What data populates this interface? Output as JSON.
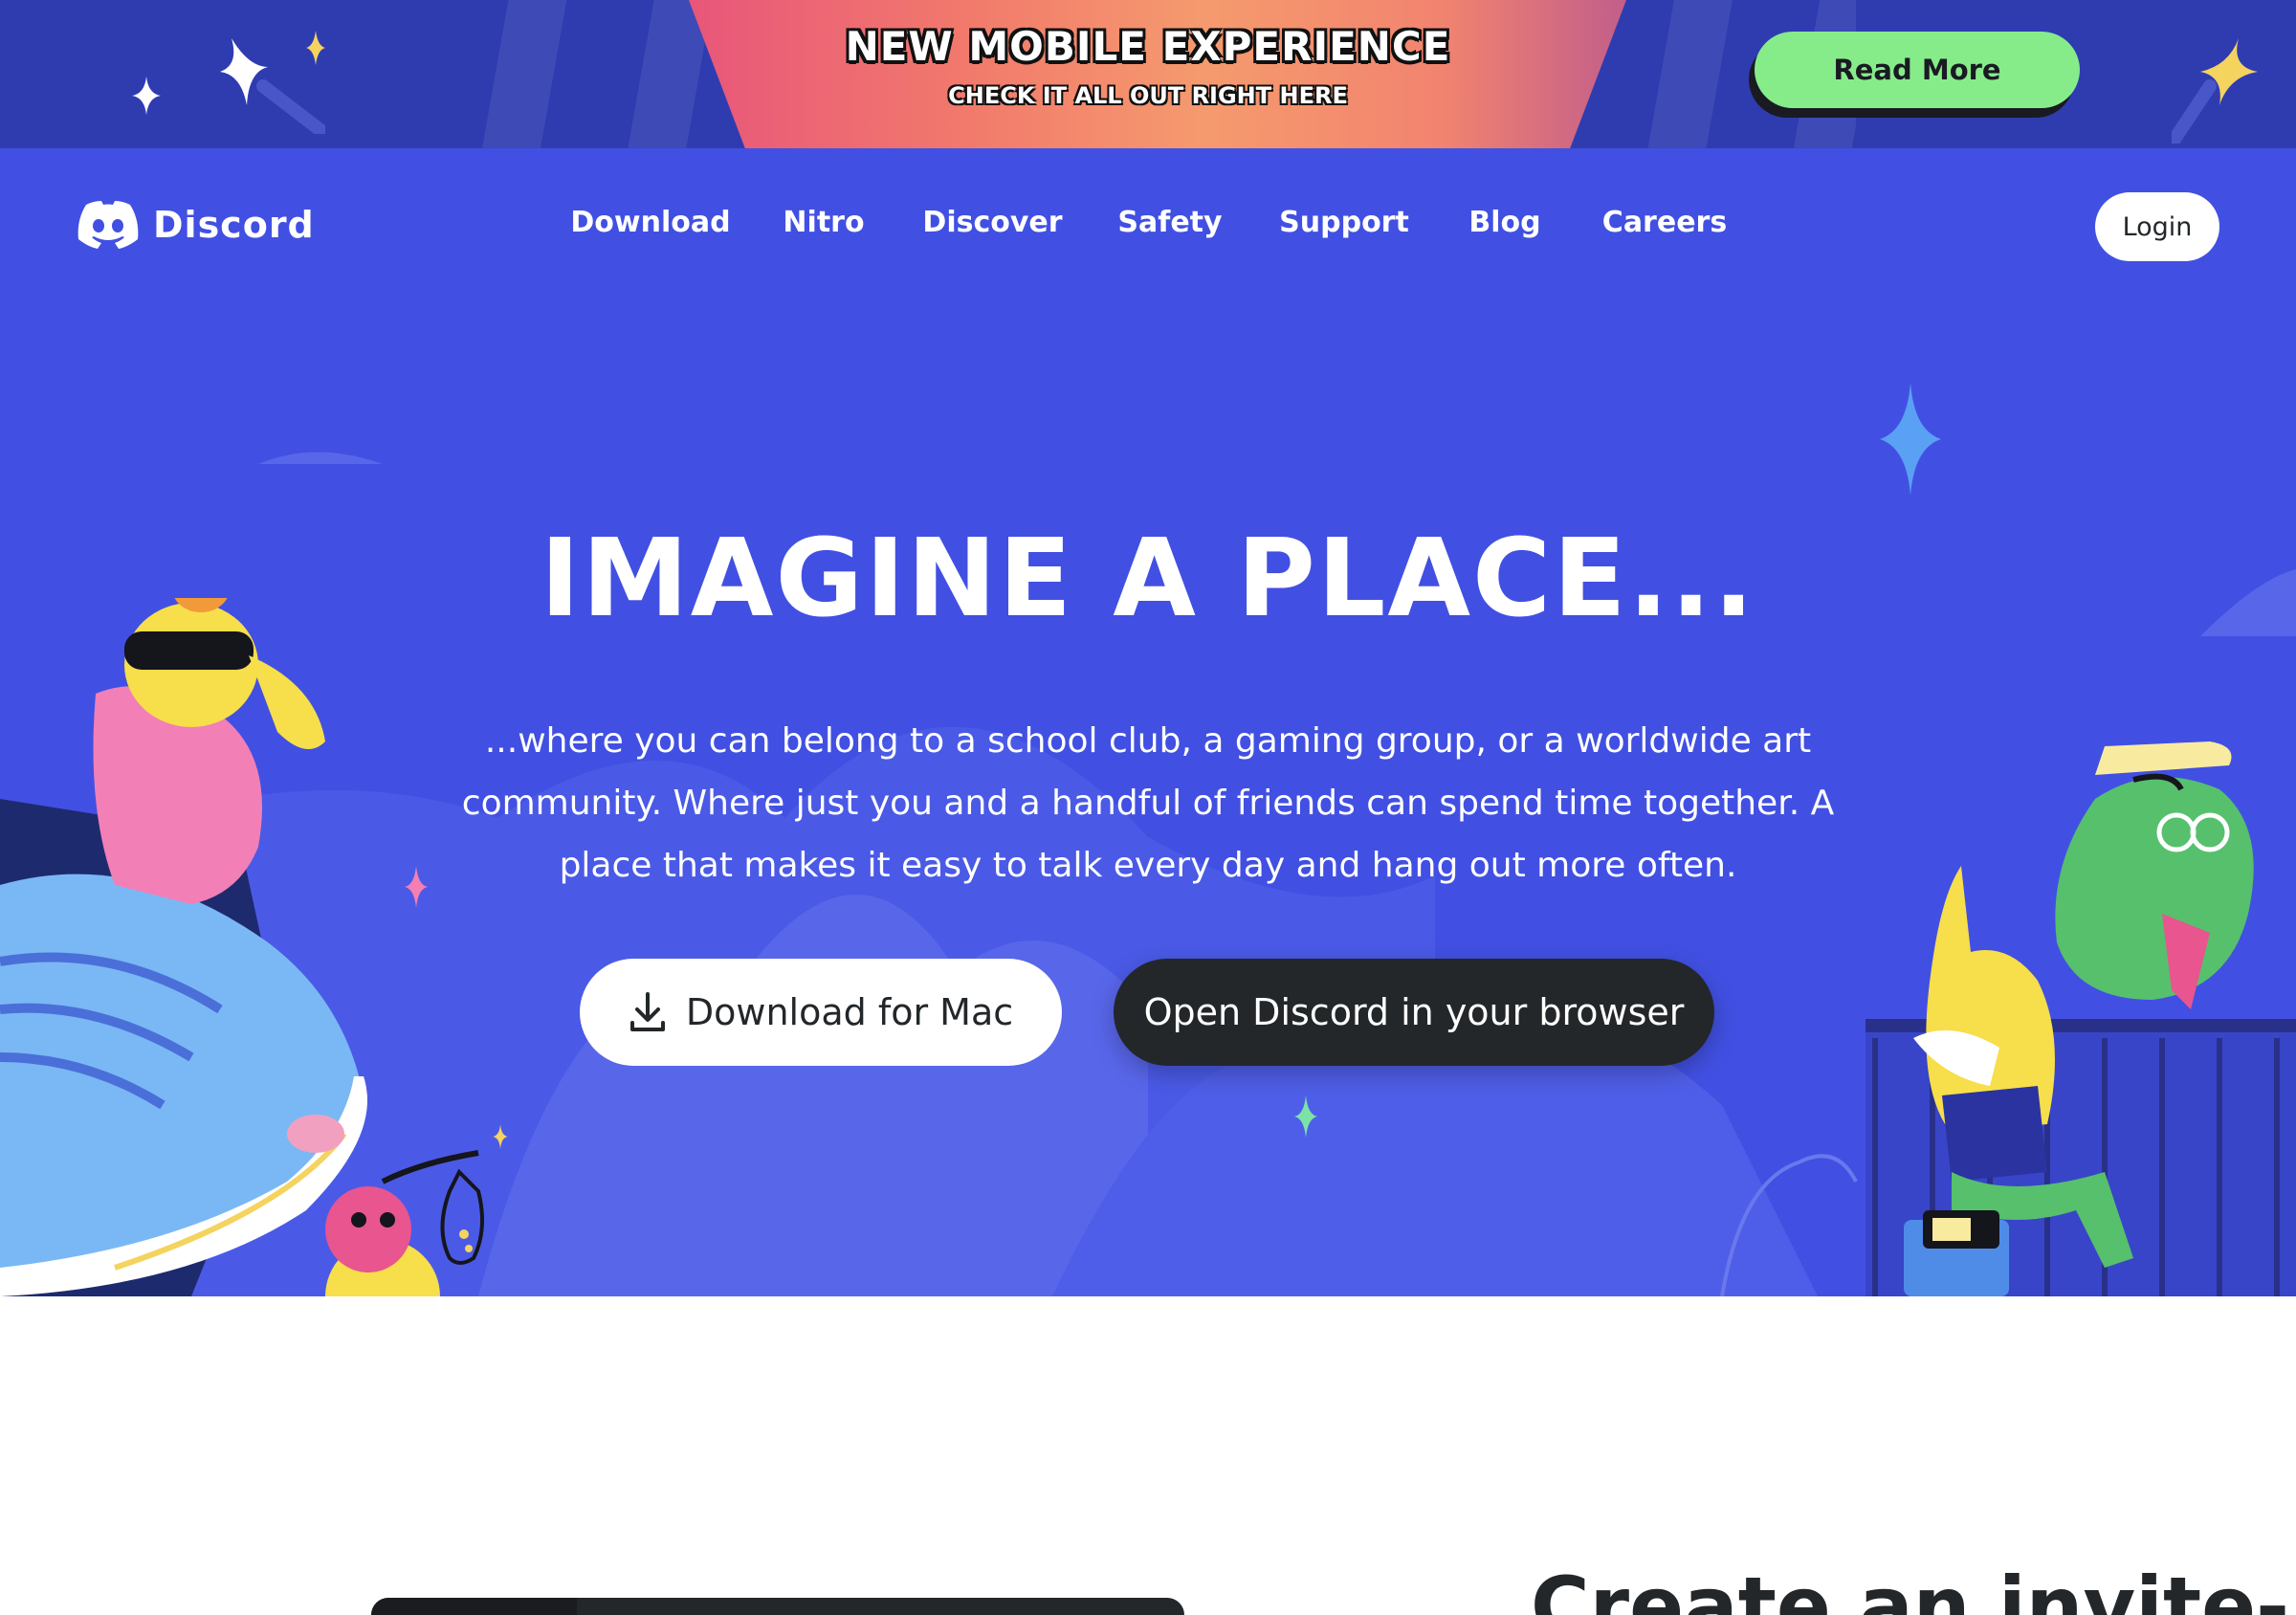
{
  "banner": {
    "title": "NEW MOBILE EXPERIENCE",
    "subtitle": "CHECK IT ALL OUT RIGHT HERE",
    "read_more": "Read More"
  },
  "nav": {
    "logo": "Discord",
    "links": [
      "Download",
      "Nitro",
      "Discover",
      "Safety",
      "Support",
      "Blog",
      "Careers"
    ],
    "login": "Login"
  },
  "hero": {
    "headline": "IMAGINE A PLACE...",
    "description": "...where you can belong to a school club, a gaming group, or a worldwide art community. Where just you and a handful of friends can spend time together. A place that makes it easy to talk every day and hang out more often.",
    "download_label": "Download for Mac",
    "browser_label": "Open Discord in your browser"
  },
  "section": {
    "title": "Create an invite-"
  },
  "colors": {
    "blurple": "#4150e2",
    "banner_navy": "#2f3cb0",
    "read_more_green": "#86ec8a",
    "dark_button": "#23272a"
  },
  "icons": [
    "discord-logo-icon",
    "download-icon",
    "sparkle-icon"
  ]
}
